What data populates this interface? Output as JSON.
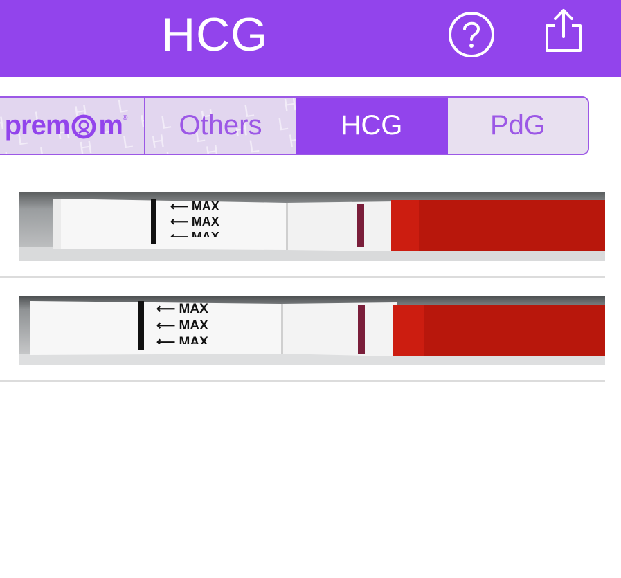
{
  "header": {
    "title": "HCG",
    "help_icon": "question-circle-icon",
    "share_icon": "share-icon"
  },
  "segments": {
    "brand": "prem",
    "brand_suffix": "m",
    "items": [
      "Others",
      "HCG",
      "PdG"
    ],
    "selected": "HCG",
    "pattern_letters": "H L H L H"
  },
  "test_strips": [
    {
      "arrow_text": [
        "MAX",
        "MAX",
        "MAX"
      ]
    },
    {
      "arrow_text": [
        "MAX",
        "MAX",
        "MAX"
      ]
    }
  ],
  "colors": {
    "accent": "#9244ec",
    "segment_bg": "#e8e0f0",
    "strip_dye": "#c41a0e",
    "test_line": "#7a1e3a"
  }
}
